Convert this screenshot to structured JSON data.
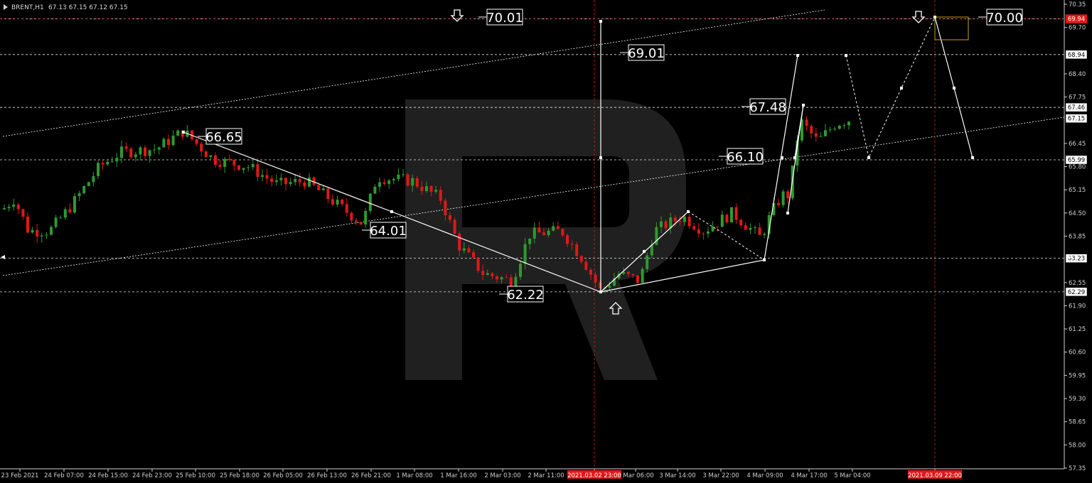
{
  "header": {
    "symbol": "BRENT,H1",
    "ohlc": "67.13 67.15 67.12 67.15"
  },
  "chart_data": {
    "type": "candlestick",
    "symbol": "BRENT",
    "timeframe": "H1",
    "ylim": [
      57.35,
      70.35
    ],
    "price_ticks": [
      "70.35",
      "69.70",
      "68.40",
      "67.75",
      "66.45",
      "65.80",
      "65.15",
      "64.50",
      "63.85",
      "62.55",
      "61.90",
      "61.25",
      "60.60",
      "59.95",
      "59.30",
      "58.65",
      "58.00",
      "57.35"
    ],
    "time_ticks": [
      "23 Feb 2021",
      "24 Feb 07:00",
      "24 Feb 15:00",
      "24 Feb 23:00",
      "25 Feb 10:00",
      "25 Feb 18:00",
      "26 Feb 05:00",
      "26 Feb 13:00",
      "26 Feb 21:00",
      "1 Mar 08:00",
      "1 Mar 16:00",
      "2 Mar 03:00",
      "2 Mar 11:00",
      "2021.03.02 23:00",
      "3 Mar 06:00",
      "3 Mar 14:00",
      "3 Mar 22:00",
      "4 Mar 09:00",
      "4 Mar 17:00",
      "5 Mar 04:00",
      "2021.03.09 22:00"
    ],
    "highlighted_time_ticks": [
      13,
      20
    ],
    "level_tags": [
      {
        "price": 69.94,
        "label": "69.94",
        "color": "#e01818"
      },
      {
        "price": 68.94,
        "label": "68.94",
        "color": "#ffffff"
      },
      {
        "price": 67.46,
        "label": "67.46",
        "color": "#ffffff"
      },
      {
        "price": 67.15,
        "label": "67.15",
        "color": "#ffffff"
      },
      {
        "price": 65.99,
        "label": "65.99",
        "color": "#ffffff"
      },
      {
        "price": 63.23,
        "label": "63.23",
        "color": "#ffffff"
      },
      {
        "price": 62.29,
        "label": "62.29",
        "color": "#ffffff"
      }
    ],
    "horizontal_levels": [
      69.94,
      68.94,
      67.46,
      65.99,
      63.23,
      62.29
    ],
    "annotations": [
      {
        "text": "70.01",
        "price": 70.01
      },
      {
        "text": "69.01",
        "price": 69.01
      },
      {
        "text": "67.48",
        "price": 67.48
      },
      {
        "text": "66.65",
        "price": 66.65
      },
      {
        "text": "66.10",
        "price": 66.1
      },
      {
        "text": "64.01",
        "price": 64.01
      },
      {
        "text": "62.22",
        "price": 62.22
      },
      {
        "text": "70.00",
        "price": 70.0
      }
    ],
    "colors": {
      "bull": "#2e9a2e",
      "bear": "#e01818",
      "grid": "#ffffff",
      "vline": "#e01818"
    }
  }
}
